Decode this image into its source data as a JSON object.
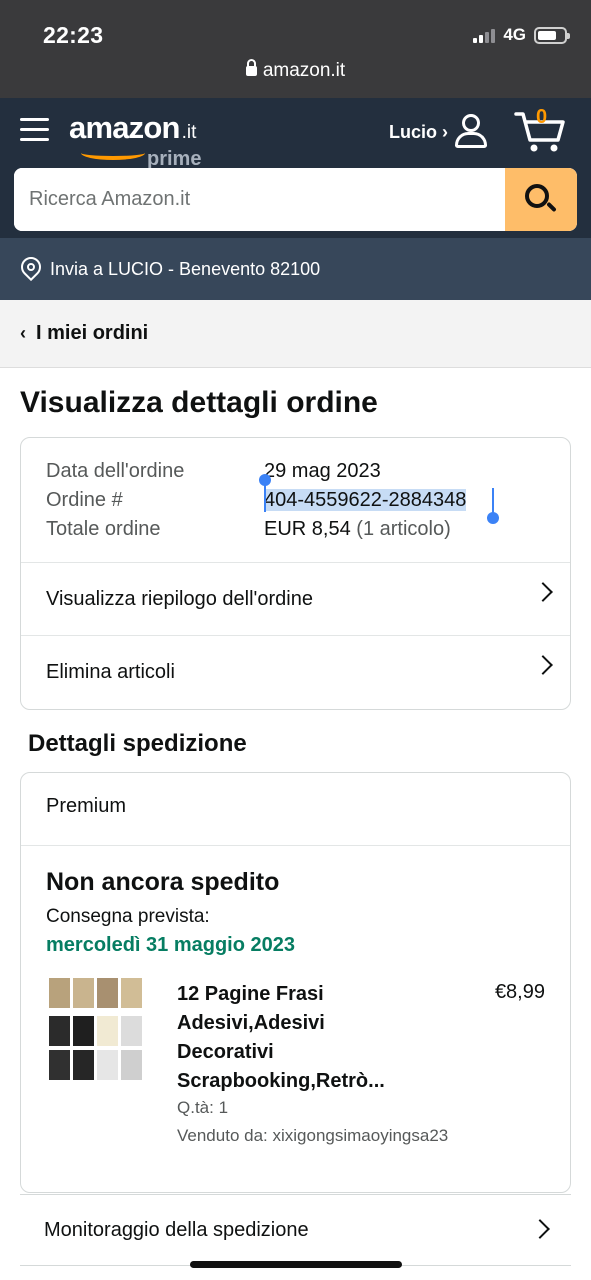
{
  "status_bar": {
    "time": "22:23",
    "network": "4G"
  },
  "browser": {
    "url": "amazon.it"
  },
  "header": {
    "logo_word": "amazon",
    "logo_tld": ".it",
    "logo_sub": "prime",
    "account_label": "Lucio ›",
    "cart_count": "0",
    "search_placeholder": "Ricerca Amazon.it",
    "accent_color": "#ff9900"
  },
  "deliver_to": "Invia a LUCIO - Benevento 82100",
  "breadcrumb": {
    "label": "I miei ordini"
  },
  "page_title": "Visualizza dettagli ordine",
  "order": {
    "date_label": "Data dell'ordine",
    "date_value": "29 mag 2023",
    "number_label": "Ordine #",
    "number_value": "404-4559622-2884348",
    "total_label": "Totale ordine",
    "total_value": "EUR 8,54",
    "total_items": "(1 articolo)",
    "links": [
      "Visualizza riepilogo dell'ordine",
      "Elimina articoli"
    ]
  },
  "shipping": {
    "section_title": "Dettagli spedizione",
    "service": "Premium",
    "status": "Non ancora spedito",
    "eta_label": "Consegna prevista:",
    "eta_date": "mercoledì 31 maggio 2023",
    "eta_color": "#067d62",
    "item": {
      "title_lines": [
        "12 Pagine Frasi",
        "Adesivi,Adesivi",
        "Decorativi",
        "Scrapbooking,Retrò..."
      ],
      "price": "€8,99",
      "qty": "Q.tà: 1",
      "seller": "Venduto da: xixigongsimaoyingsa23"
    },
    "tracking_label": "Monitoraggio della spedizione"
  }
}
